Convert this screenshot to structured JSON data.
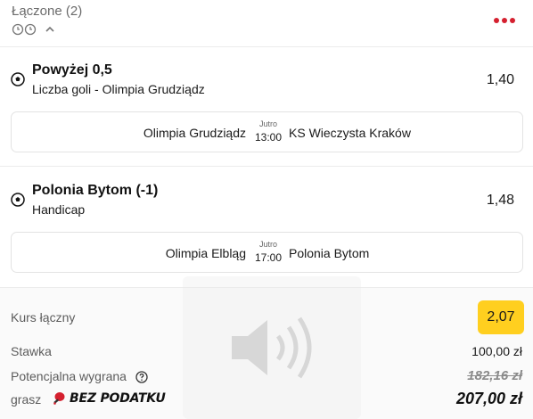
{
  "header": {
    "title": "Łączone (2)"
  },
  "selections": [
    {
      "title": "Powyżej 0,5",
      "market": "Liczba goli - Olimpia Grudziądz",
      "odds": "1,40",
      "match": {
        "home": "Olimpia Grudziądz",
        "away": "KS Wieczysta Kraków",
        "day": "Jutro",
        "time": "13:00"
      }
    },
    {
      "title": "Polonia Bytom (-1)",
      "market": "Handicap",
      "odds": "1,48",
      "match": {
        "home": "Olimpia Elbląg",
        "away": "Polonia Bytom",
        "day": "Jutro",
        "time": "17:00"
      }
    }
  ],
  "summary": {
    "total_odds_label": "Kurs łączny",
    "total_odds_value": "2,07",
    "stake_label": "Stawka",
    "stake_value": "100,00 zł",
    "potential_win_label": "Potencjalna wygrana",
    "potential_win_value": "182,16 zł",
    "promo_prefix": "grasz",
    "promo_badge": "BEZ PODATKU",
    "promo_value": "207,00 zł"
  },
  "colors": {
    "accent_red": "#d5202f",
    "odds_badge": "#ffcf1f"
  },
  "icons": {
    "header": [
      "clock-icon",
      "clock-icon",
      "chevron-up-icon",
      "more-menu-icon"
    ],
    "selection": "soccer-ball-icon",
    "help": "question-icon",
    "promo": "ping-pong-paddle-icon",
    "overlay": "speaker-icon"
  }
}
